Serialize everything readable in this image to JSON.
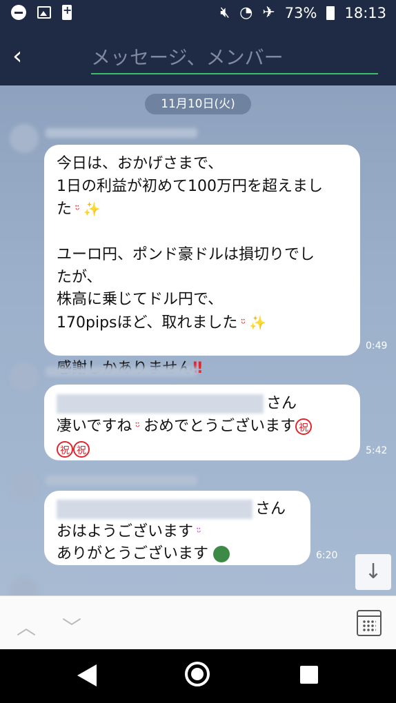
{
  "status_bar": {
    "battery_percent": "73%",
    "time": "18:13"
  },
  "header": {
    "search_placeholder": "メッセージ、メンバー"
  },
  "chat": {
    "date_label": "11月10日(火)",
    "messages": [
      {
        "lines": [
          "今日は、おかげさまで、",
          "1日の利益が初めて100万円を超えまし",
          "た",
          "",
          "ユーロ円、ポンド豪ドルは損切りでし",
          "たが、",
          "株高に乗じてドル円で、",
          "170pipsほど、取れました",
          "",
          "感謝しかありません"
        ],
        "time": "0:49"
      },
      {
        "mention_suffix": "さん",
        "line2": "凄いですね",
        "line2b": "おめでとうございます",
        "time": "5:42"
      },
      {
        "mention_suffix": "さん",
        "line2": "おはようございます",
        "line3": "ありがとうございます",
        "time": "6:20"
      }
    ],
    "emoji_iwai": "祝",
    "bang": "‼"
  },
  "icons": {
    "back": "chevron-left-icon",
    "scroll": "arrow-down-icon",
    "calendar": "calendar-icon"
  }
}
